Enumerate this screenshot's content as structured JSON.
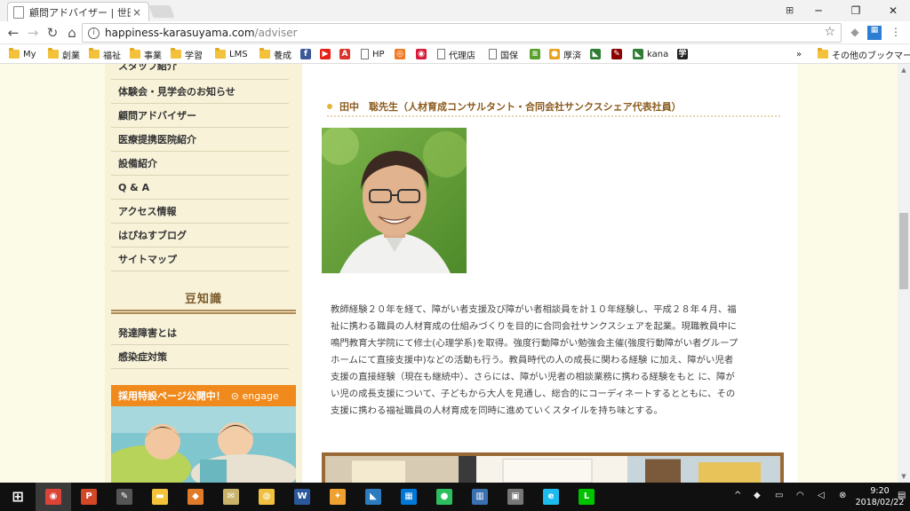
{
  "browser": {
    "tab_title": "顧問アドバイザー | 世田谷区",
    "tab_close": "×",
    "window_controls": {
      "minimize": "─",
      "restore": "❐",
      "close": "✕"
    },
    "url_host": "happiness-karasuyama.com",
    "url_path": "/adviser",
    "info_glyph": "i",
    "star_glyph": "☆",
    "extension_glyph": "⊞"
  },
  "bookmarks": [
    {
      "label": "My",
      "icon": "folder"
    },
    {
      "label": "創業",
      "icon": "folder"
    },
    {
      "label": "福祉",
      "icon": "folder"
    },
    {
      "label": "事業",
      "icon": "folder"
    },
    {
      "label": "学習",
      "icon": "folder"
    },
    {
      "label": "LMS",
      "icon": "folder"
    },
    {
      "label": "養成",
      "icon": "folder"
    },
    {
      "label": "",
      "icon": "facebook-icon",
      "glyph": "f",
      "color": "#3b5998"
    },
    {
      "label": "",
      "icon": "youtube-icon",
      "glyph": "▶",
      "color": "#e62117"
    },
    {
      "label": "",
      "icon": "a-logo-icon",
      "glyph": "A",
      "color": "#d9342b"
    },
    {
      "label": "HP",
      "icon": "page"
    },
    {
      "label": "",
      "icon": "swirl-icon",
      "glyph": "◎",
      "color": "#f07a22"
    },
    {
      "label": "",
      "icon": "orbit-icon",
      "glyph": "◉",
      "color": "#d61c3a"
    },
    {
      "label": "代理店",
      "icon": "page"
    },
    {
      "label": "国保",
      "icon": "page"
    },
    {
      "label": "",
      "icon": "stack-icon",
      "glyph": "≋",
      "color": "#5aa02c"
    },
    {
      "label": "厚済",
      "icon": "colorful-icon",
      "glyph": "●",
      "color": "#e8a21e"
    },
    {
      "label": "",
      "icon": "mail-icon",
      "glyph": "◣",
      "color": "#2e7d32"
    },
    {
      "label": "",
      "icon": "tool-icon",
      "glyph": "✎",
      "color": "#8b0000"
    },
    {
      "label": "kana",
      "icon": "kana-icon",
      "glyph": "◣",
      "color": "#2e7d32"
    },
    {
      "label": "",
      "icon": "kanji-icon",
      "glyph": "学",
      "color": "#222222"
    }
  ],
  "bookmarks_overflow": "»",
  "other_bookmarks": "その他のブックマーク",
  "sidebar": {
    "menu": [
      "スタッフ紹介",
      "体験会・見学会のお知らせ",
      "顧問アドバイザー",
      "医療提携医院紹介",
      "設備紹介",
      "Q & A",
      "アクセス情報",
      "はぴねすブログ",
      "サイトマップ"
    ],
    "tips_heading": "豆知識",
    "tips_menu": [
      "発達障害とは",
      "感染症対策"
    ],
    "recruit_banner": "採用特設ページ公開中！",
    "recruit_brand": "engage"
  },
  "main": {
    "adviser_heading": "田中　聡先生（人材育成コンサルタント・合同会社サンクスシェア代表社員）",
    "bio": "教師経験２０年を経て、障がい者支援及び障がい者相談員を計１０年経験し、平成２８年４月、福\n祉に携わる職員の人材育成の仕組みづくりを目的に合同会社サンクスシェアを起業。現職教員中に\n鳴門教育大学院にて修士(心理学系)を取得。強度行動障がい勉強会主催(強度行動障がい者グループ\nホームにて直接支援中)などの活動も行う。教員時代の人の成長に関わる経験 に加え、障がい児者\n支援の直接経験（現在も継続中）、さらには、障がい児者の相談業務に携わる経験をもと に、障が\nい児の成長支援について、子どもから大人を見通し、総合的にコーディネートするとともに、その\n支援に携わる福祉職員の人材育成を同時に進めていくスタイルを持ち味とする。"
  },
  "taskbar": {
    "apps": [
      {
        "name": "windows-start-icon",
        "glyph": "⊞",
        "color": "#101010"
      },
      {
        "name": "chrome-icon",
        "glyph": "◉",
        "color": "#db4437",
        "active": true
      },
      {
        "name": "powerpoint-icon",
        "glyph": "P",
        "color": "#d24726"
      },
      {
        "name": "pen-tool-icon",
        "glyph": "✎",
        "color": "#555555"
      },
      {
        "name": "file-explorer-icon",
        "glyph": "▬",
        "color": "#f3c13a"
      },
      {
        "name": "gift-app-icon",
        "glyph": "◆",
        "color": "#e07b2a"
      },
      {
        "name": "notes-app-icon",
        "glyph": "✉",
        "color": "#c9b26a"
      },
      {
        "name": "disc-app-icon",
        "glyph": "◍",
        "color": "#f0c040"
      },
      {
        "name": "word-icon",
        "glyph": "W",
        "color": "#2b579a"
      },
      {
        "name": "tools-app-icon",
        "glyph": "✦",
        "color": "#f0a030"
      },
      {
        "name": "pdf-editor-icon",
        "glyph": "◣",
        "color": "#2c7bbf"
      },
      {
        "name": "store-icon",
        "glyph": "▦",
        "color": "#0078d7"
      },
      {
        "name": "evernote-icon",
        "glyph": "●",
        "color": "#2dbe60"
      },
      {
        "name": "chart-app-icon",
        "glyph": "▥",
        "color": "#3a6fb0"
      },
      {
        "name": "network-app-icon",
        "glyph": "▣",
        "color": "#777777"
      },
      {
        "name": "internet-explorer-icon",
        "glyph": "e",
        "color": "#1ebbee"
      },
      {
        "name": "line-icon",
        "glyph": "L",
        "color": "#00c300"
      }
    ],
    "time": "9:20",
    "date": "2018/02/22",
    "tray": {
      "chevron": "^",
      "dropbox": "◆",
      "battery": "▭",
      "wifi": "◠",
      "volume": "◁",
      "close": "⊗",
      "notifications": "▤"
    }
  }
}
